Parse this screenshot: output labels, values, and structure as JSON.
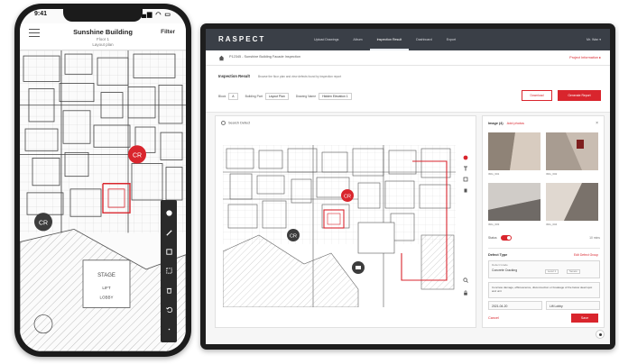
{
  "phone": {
    "time": "9:41",
    "status_icons": "▂▄▆ ◠ ▭",
    "title": "Sunshine Building",
    "subtitle_1": "Floor 1",
    "subtitle_2": "Layout plan",
    "filter_label": "Filter",
    "markers": [
      {
        "label": "CR",
        "color": "#d9252d"
      },
      {
        "label": "CR",
        "color": "#3c3c3c"
      }
    ],
    "plan_labels": [
      "STAGE",
      "LIFT",
      "LOBBY"
    ],
    "tools": [
      "circle-tool",
      "pen-tool",
      "square-tool",
      "dashed-square-tool",
      "trash-tool",
      "undo-tool"
    ]
  },
  "laptop": {
    "logo": "RASPECT",
    "nav": [
      "Upload Drawings",
      "Album",
      "Inspection Result",
      "Dashboard",
      "Export"
    ],
    "nav_active_index": 2,
    "user": "Mr. Wan ▾",
    "breadcrumb": "P12345 - Sunshine Building Facade Inspection",
    "project_info": "Project Information ▸",
    "info": {
      "title": "Inspection Result",
      "desc": "Browse the floor plan and view defects found by inspection report",
      "selects": [
        {
          "label": "Block",
          "value": "A"
        },
        {
          "label": "Building Part",
          "value": "Layout Plan"
        },
        {
          "label": "Drawing Name",
          "value": "Hidden Elevation 1"
        }
      ],
      "btn_download": "Download",
      "btn_generate": "Generate Report"
    },
    "search_placeholder": "Search Defect",
    "markers": [
      {
        "label": "CR",
        "color": "#d9252d"
      },
      {
        "label": "CR",
        "color": "#3c3c3c"
      },
      {
        "label": "",
        "color": "#3c3c3c"
      }
    ],
    "side": {
      "images_label": "Image (4)",
      "images_link": "Add photos",
      "thumbs": [
        {
          "caption": "IMG_001",
          "tone": "#b8ab9e"
        },
        {
          "caption": "IMG_002",
          "tone": "#c9bdb2"
        },
        {
          "caption": "IMG_003",
          "tone": "#9d9792"
        },
        {
          "caption": "IMG_004",
          "tone": "#a89f96"
        }
      ],
      "status_label": "Status",
      "status_extra": "10 mins",
      "defect_header": "Defect Type",
      "defect_link": "Edit Defect Group",
      "defect_field_label": "Defect Grade",
      "defect_field_value": "Concrete Cracking",
      "chips": [
        "Level 1",
        "Severe"
      ],
      "note_value": "Concrete damage, efflorescence, disconnection or breakage of the below dead spot and unit",
      "meta_fields": [
        {
          "label": "Date",
          "value": "2021-04-20"
        },
        {
          "label": "Location",
          "value": "Lift Lobby"
        }
      ],
      "cancel_label": "Cancel",
      "save_label": "Save"
    }
  }
}
